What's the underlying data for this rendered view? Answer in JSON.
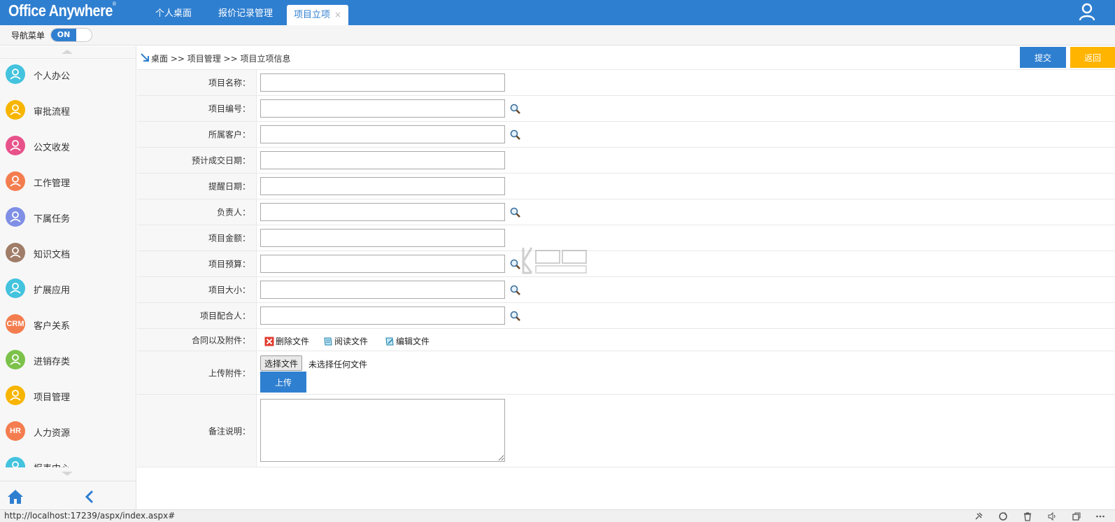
{
  "app": {
    "logo_text": "Office Anywhere",
    "logo_mark": "®"
  },
  "tabs": [
    {
      "label": "个人桌面"
    },
    {
      "label": "报价记录管理"
    },
    {
      "label": "项目立项",
      "close": "×",
      "active": true
    }
  ],
  "nav": {
    "label": "导航菜单",
    "toggle_state": "ON"
  },
  "sidebar": {
    "items": [
      {
        "label": "个人办公",
        "icon": "person-icon",
        "color": "#43c3de",
        "glyph": ""
      },
      {
        "label": "审批流程",
        "icon": "approval-icon",
        "color": "#f7b500",
        "glyph": ""
      },
      {
        "label": "公文收发",
        "icon": "document-exchange-icon",
        "color": "#e8528a",
        "glyph": ""
      },
      {
        "label": "工作管理",
        "icon": "work-icon",
        "color": "#f47d4f",
        "glyph": ""
      },
      {
        "label": "下属任务",
        "icon": "team-icon",
        "color": "#7f8fe6",
        "glyph": ""
      },
      {
        "label": "知识文档",
        "icon": "book-icon",
        "color": "#a07d68",
        "glyph": ""
      },
      {
        "label": "扩展应用",
        "icon": "extension-icon",
        "color": "#43c3de",
        "glyph": ""
      },
      {
        "label": "客户关系",
        "icon": "crm-icon",
        "color": "#f47d4f",
        "glyph": "CRM"
      },
      {
        "label": "进销存类",
        "icon": "inventory-icon",
        "color": "#7cc24a",
        "glyph": ""
      },
      {
        "label": "项目管理",
        "icon": "project-icon",
        "color": "#f7b500",
        "glyph": ""
      },
      {
        "label": "人力资源",
        "icon": "hr-icon",
        "color": "#f47d4f",
        "glyph": "HR"
      },
      {
        "label": "报表中心",
        "icon": "report-icon",
        "color": "#43c3de",
        "glyph": ""
      }
    ]
  },
  "breadcrumb": {
    "text": "桌面 >> 项目管理 >> 项目立项信息"
  },
  "actions": {
    "submit": "提交",
    "back": "返回"
  },
  "form": {
    "fields": [
      {
        "label": "项目名称：",
        "value": "",
        "lookup": false
      },
      {
        "label": "项目编号：",
        "value": "",
        "lookup": true
      },
      {
        "label": "所属客户：",
        "value": "",
        "lookup": true
      },
      {
        "label": "预计成交日期：",
        "value": "",
        "lookup": false
      },
      {
        "label": "提醒日期：",
        "value": "",
        "lookup": false
      },
      {
        "label": "负责人：",
        "value": "",
        "lookup": true
      },
      {
        "label": "项目金额：",
        "value": "",
        "lookup": false
      },
      {
        "label": "项目预算：",
        "value": "",
        "lookup": true
      },
      {
        "label": "项目大小：",
        "value": "",
        "lookup": true
      },
      {
        "label": "项目配合人：",
        "value": "",
        "lookup": true
      }
    ],
    "attachments": {
      "label": "合同以及附件：",
      "delete": "删除文件",
      "read": "阅读文件",
      "edit": "编辑文件"
    },
    "upload": {
      "label": "上传附件：",
      "choose": "选择文件",
      "no_file": "未选择任何文件",
      "upload_button": "上传"
    },
    "remark": {
      "label": "备注说明：",
      "value": ""
    }
  },
  "status": {
    "url": "http://localhost:17239/aspx/index.aspx#"
  },
  "colors": {
    "primary": "#2f7fd0",
    "warning": "#ffb400"
  }
}
